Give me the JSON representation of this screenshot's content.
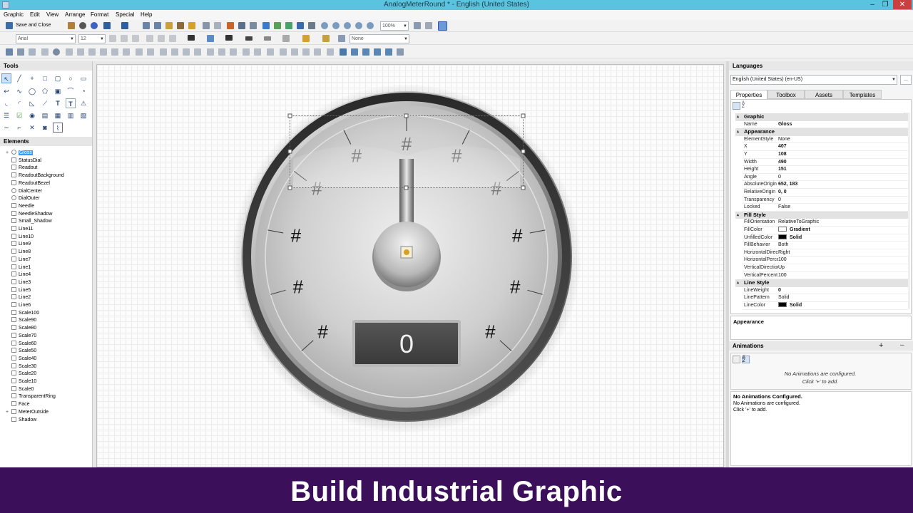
{
  "window": {
    "title": "AnalogMeterRound * - English (United States)",
    "minimize": "–",
    "restore": "❐",
    "close": "✕"
  },
  "menu": [
    "Graphic",
    "Edit",
    "View",
    "Arrange",
    "Format",
    "Special",
    "Help"
  ],
  "toolbar": {
    "save_close": "Save and Close",
    "zoom": "100%",
    "font_name": "Arial",
    "font_size": "12",
    "style_value": "None"
  },
  "tools": {
    "title": "Tools"
  },
  "elements": {
    "title": "Elements",
    "items": [
      "Gloss",
      "StatusDial",
      "Readout",
      "ReadoutBackground",
      "ReadoutBezel",
      "DialCenter",
      "DialOuter",
      "Needle",
      "NeedleShadow",
      "Small_Shadow",
      "Line11",
      "Line10",
      "Line9",
      "Line8",
      "Line7",
      "Line1",
      "Line4",
      "Line3",
      "Line5",
      "Line2",
      "Line6",
      "Scale100",
      "Scale90",
      "Scale80",
      "Scale70",
      "Scale60",
      "Scale50",
      "Scale40",
      "Scale30",
      "Scale20",
      "Scale10",
      "Scale0",
      "TransparentRing",
      "Face",
      "MeterOutside",
      "Shadow"
    ]
  },
  "meter": {
    "scale_label": "#",
    "readout": "0"
  },
  "languages": {
    "title": "Languages",
    "selected": "English (United States) (en-US)",
    "more": "..."
  },
  "tabs": [
    "Properties",
    "Toolbox",
    "Assets",
    "Templates"
  ],
  "properties": {
    "cat_graphic": "Graphic",
    "name_label": "Name",
    "name_value": "Gloss",
    "cat_appearance": "Appearance",
    "appearance_rows": [
      {
        "name": "ElementStyle",
        "value": "None"
      },
      {
        "name": "X",
        "value": "407"
      },
      {
        "name": "Y",
        "value": "108"
      },
      {
        "name": "Width",
        "value": "490"
      },
      {
        "name": "Height",
        "value": "151"
      },
      {
        "name": "Angle",
        "value": "0"
      },
      {
        "name": "AbsoluteOrigin",
        "value": "652, 183"
      },
      {
        "name": "RelativeOrigin",
        "value": "0, 0"
      },
      {
        "name": "Transparency",
        "value": "0"
      },
      {
        "name": "Locked",
        "value": "False"
      }
    ],
    "cat_fill": "Fill Style",
    "fill_rows": [
      {
        "name": "FillOrientation",
        "value": "RelativeToGraphic"
      },
      {
        "name": "FillColor",
        "value": "Gradient"
      },
      {
        "name": "UnfilledColor",
        "value": "Solid"
      },
      {
        "name": "FillBehavior",
        "value": "Both"
      },
      {
        "name": "HorizontalDirection",
        "value": "Right"
      },
      {
        "name": "HorizontalPercent",
        "value": "100"
      },
      {
        "name": "VerticalDirection",
        "value": "Up"
      },
      {
        "name": "VerticalPercent",
        "value": "100"
      }
    ],
    "cat_line": "Line Style",
    "line_rows": [
      {
        "name": "LineWeight",
        "value": "0"
      },
      {
        "name": "LinePattern",
        "value": "Solid"
      },
      {
        "name": "LineColor",
        "value": "Solid"
      }
    ],
    "description_title": "Appearance"
  },
  "animations": {
    "title": "Animations",
    "add": "+",
    "empty_line1": "No Animations are configured.",
    "empty_line2": "Click '+' to add.",
    "summary_title": "No Animations Configured.",
    "summary_line1": "No Animations are configured.",
    "summary_line2": "Click '+' to add."
  },
  "banner": {
    "text": "Build Industrial Graphic"
  },
  "colors": {
    "titlebar": "#5ac4de",
    "banner": "#3c0f5b",
    "selection": "#3399ff"
  }
}
